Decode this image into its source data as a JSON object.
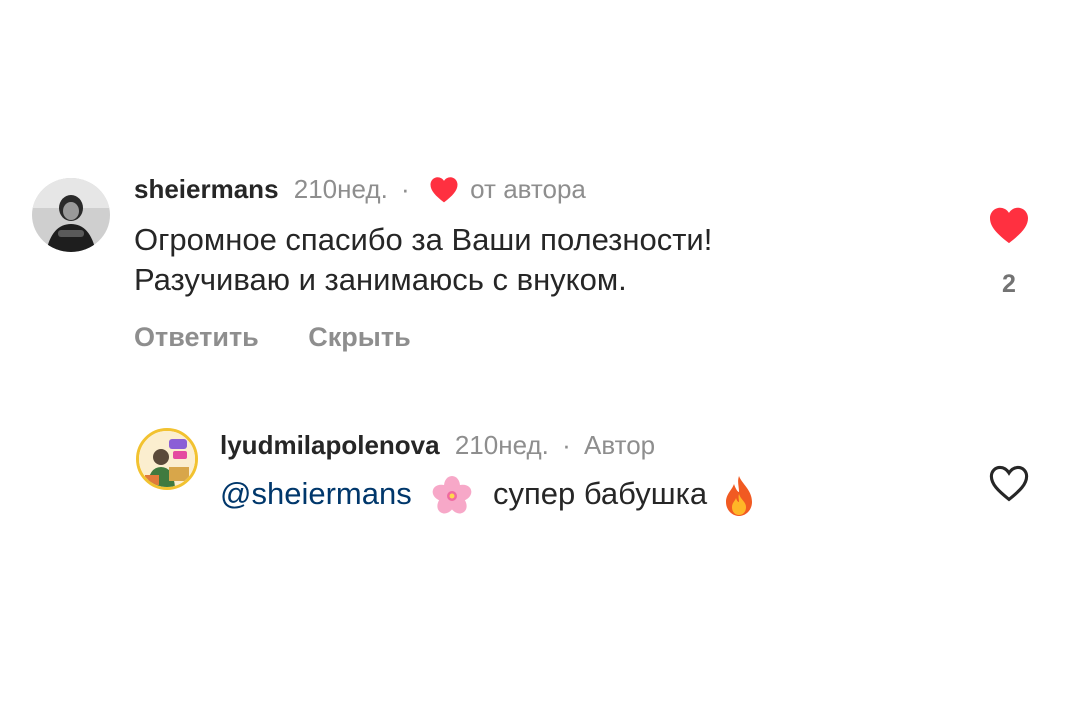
{
  "comments": [
    {
      "username": "sheiermans",
      "time": "210нед.",
      "separator": "·",
      "author_like_label": "от автора",
      "text_lines": [
        "Огромное спасибо за Ваши полезности!",
        "Разучиваю и занимаюсь с внуком."
      ],
      "liked": true,
      "like_count": "2",
      "actions": {
        "reply": "Ответить",
        "hide": "Скрыть"
      }
    }
  ],
  "reply": {
    "username": "lyudmilapolenova",
    "time": "210нед.",
    "separator": "·",
    "badge": "Автор",
    "mention": "@sheiermans",
    "text": "супер бабушка",
    "emojis": [
      "cherry-blossom-icon",
      "fire-icon"
    ],
    "liked": false
  },
  "colors": {
    "like_red": "#ff3040",
    "mention_blue": "#00376b",
    "secondary_gray": "#8e8e8e",
    "primary_text": "#262626"
  }
}
